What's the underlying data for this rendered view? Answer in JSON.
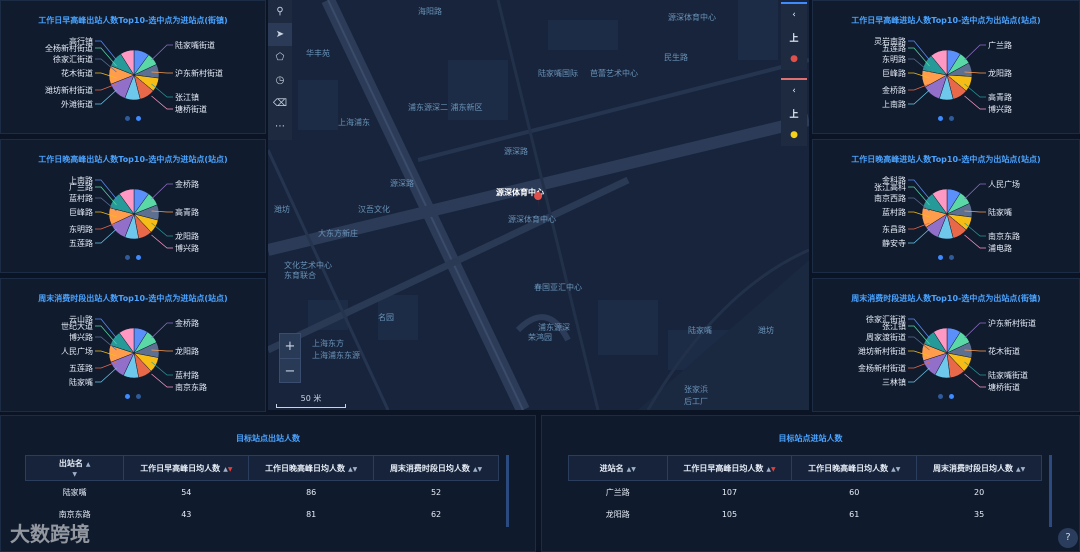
{
  "pies": [
    {
      "title": "工作日早高峰出站人数Top10-选中点为进站点(街镇)",
      "labels": [
        "高行镇",
        "全杨新村街道",
        "徐家汇街道",
        "花木街道",
        "潍坊新村街道",
        "外滩街道",
        "陆家嘴街道",
        "沪东新村街道",
        "张江镇",
        "塘桥街道"
      ],
      "values": [
        10,
        8,
        9,
        9,
        10,
        10,
        13,
        12,
        10,
        9
      ],
      "dot_active": 1
    },
    {
      "title": "工作日晚高峰出站人数Top10-选中点为进站点(站点)",
      "labels": [
        "上南路",
        "广兰路",
        "蓝村路",
        "巨峰路",
        "东明路",
        "五莲路",
        "金桥路",
        "高青路",
        "龙阳路",
        "博兴路"
      ],
      "values": [
        10,
        9,
        10,
        9,
        9,
        9,
        12,
        11,
        11,
        10
      ],
      "dot_active": 1
    },
    {
      "title": "周末消费时段出站人数Top10-选中点为进站点(站点)",
      "labels": [
        "云山路",
        "世纪大道",
        "博兴路",
        "人民广场",
        "五莲路",
        "陆家嘴",
        "金桥路",
        "龙阳路",
        "蓝村路",
        "南京东路"
      ],
      "values": [
        9,
        9,
        10,
        10,
        9,
        10,
        12,
        11,
        10,
        10
      ],
      "dot_active": 0
    },
    {
      "title": "工作日早高峰进站人数Top10-选中点为出站点(站点)",
      "labels": [
        "灵岩南路",
        "五莲路",
        "东明路",
        "巨峰路",
        "金桥路",
        "上南路",
        "广兰路",
        "龙阳路",
        "高青路",
        "博兴路"
      ],
      "values": [
        9,
        8,
        9,
        10,
        10,
        9,
        12,
        11,
        11,
        11
      ],
      "dot_active": 0
    },
    {
      "title": "工作日晚高峰进站人数Top10-选中点为出站点(站点)",
      "labels": [
        "金科路",
        "张江高科",
        "南京西路",
        "蓝村路",
        "东昌路",
        "静安寺",
        "人民广场",
        "陆家嘴",
        "南京东路",
        "浦电路"
      ],
      "values": [
        9,
        9,
        9,
        9,
        10,
        10,
        10,
        13,
        11,
        10
      ],
      "dot_active": 0
    },
    {
      "title": "周末消费时段进站人数Top10-选中点为出站点(街镇)",
      "labels": [
        "徐家汇街道",
        "张江镇",
        "周家渡街道",
        "潍坊新村街道",
        "金杨新村街道",
        "三林镇",
        "沪东新村街道",
        "花木街道",
        "陆家嘴街道",
        "塘桥街道"
      ],
      "values": [
        9,
        9,
        10,
        10,
        10,
        10,
        12,
        11,
        10,
        9
      ],
      "dot_active": 1
    }
  ],
  "pie_colors": [
    "#5b8ff9",
    "#5ad8a6",
    "#5d7092",
    "#f6bd16",
    "#e8684a",
    "#6dc8ec",
    "#9270ca",
    "#ff9d4d",
    "#269a99",
    "#ff99c3"
  ],
  "map": {
    "toolbar_icons": [
      "search-icon",
      "navigate-icon",
      "draw-polygon-icon",
      "clock-icon",
      "trash-icon",
      "more-icon"
    ],
    "marker_label": "源深体育中心",
    "place_labels": [
      "海阳路",
      "浦东源深二 浦东新区",
      "陆家嘴国际",
      "芭蕾艺术中心",
      "上海浦东",
      "源深路",
      "民生路",
      "源深体育中心",
      "源深体育中心",
      "汉吾文化",
      "潍坊",
      "大东方新庄",
      "源深路",
      "文化艺术中心",
      "东育联合",
      "春国亚汇中心",
      "浦东源深",
      "名园",
      "荣鸿园",
      "上海东方",
      "上海浦东东源",
      "陆家嘴",
      "潍坊",
      "张家浜",
      "后工厂",
      "华丰苑"
    ],
    "scale_label": "50 米",
    "zoom_in": "+",
    "zoom_out": "−",
    "right_ctl_1": [
      "‹",
      "上"
    ],
    "right_ctl_2": [
      "‹",
      "上"
    ]
  },
  "left_table": {
    "title": "目标站点出站人数",
    "columns": [
      "出站名",
      "工作日早高峰日均人数",
      "工作日晚高峰日均人数",
      "周末消费时段日均人数"
    ],
    "rows": [
      [
        "陆家嘴",
        "54",
        "86",
        "52"
      ],
      [
        "南京东路",
        "43",
        "81",
        "62"
      ]
    ]
  },
  "right_table": {
    "title": "目标站点进站人数",
    "columns": [
      "进站名",
      "工作日早高峰日均人数",
      "工作日晚高峰日均人数",
      "周末消费时段日均人数"
    ],
    "rows": [
      [
        "广兰路",
        "107",
        "60",
        "20"
      ],
      [
        "龙阳路",
        "105",
        "61",
        "35"
      ]
    ]
  },
  "watermark": "大数跨境"
}
